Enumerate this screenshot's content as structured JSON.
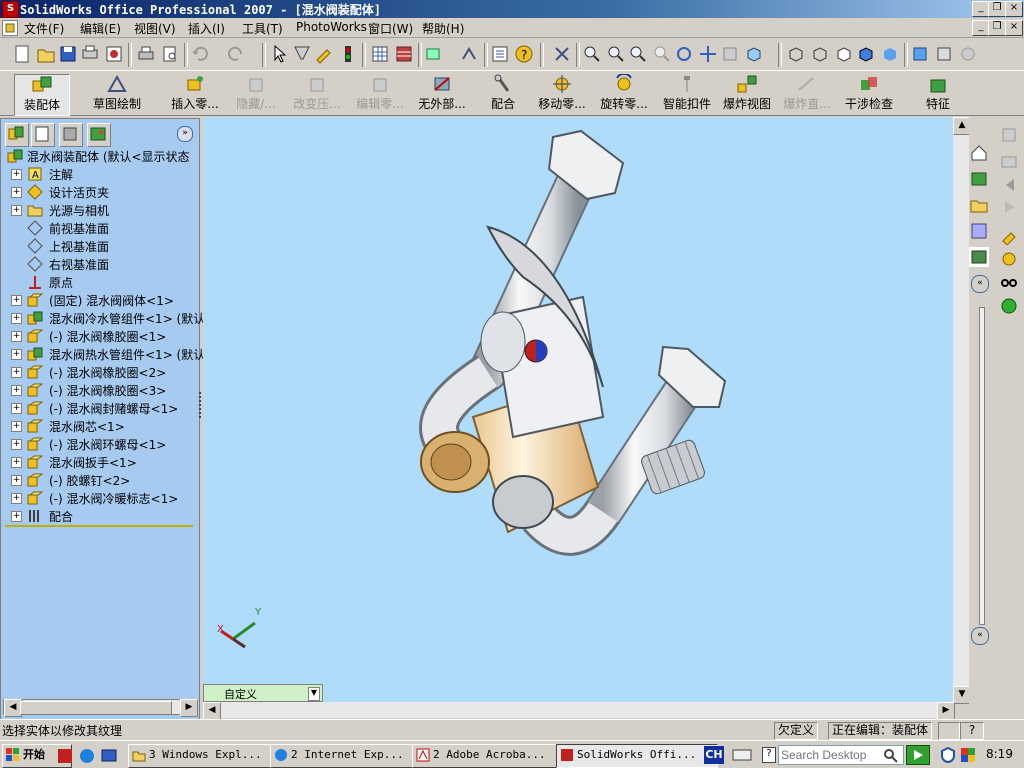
{
  "window": {
    "title": "SolidWorks Office Professional 2007 - [混水阀装配体]",
    "controls": {
      "minimize": "_",
      "restore": "❐",
      "close": "×"
    }
  },
  "menu": {
    "items": [
      "文件(F)",
      "编辑(E)",
      "视图(V)",
      "插入(I)",
      "工具(T)",
      "PhotoWorks",
      "窗口(W)",
      "帮助(H)"
    ]
  },
  "command_manager": {
    "buttons": [
      {
        "label": "装配体",
        "enabled": true
      },
      {
        "label": "草图绘制",
        "enabled": true
      },
      {
        "label": "插入零...",
        "enabled": true
      },
      {
        "label": "隐藏/...",
        "enabled": false
      },
      {
        "label": "改变压...",
        "enabled": false
      },
      {
        "label": "编辑零...",
        "enabled": false
      },
      {
        "label": "无外部...",
        "enabled": true
      },
      {
        "label": "配合",
        "enabled": true
      },
      {
        "label": "移动零...",
        "enabled": true
      },
      {
        "label": "旋转零...",
        "enabled": true
      },
      {
        "label": "智能扣件",
        "enabled": true
      },
      {
        "label": "爆炸视图",
        "enabled": true
      },
      {
        "label": "爆炸直...",
        "enabled": false
      },
      {
        "label": "干涉检查",
        "enabled": true
      },
      {
        "label": "特征",
        "enabled": true
      }
    ]
  },
  "feature_tree": {
    "root": "混水阀装配体  (默认<显示状态",
    "items": [
      {
        "label": "注解",
        "icon": "annotation-icon",
        "expander": "+"
      },
      {
        "label": "设计活页夹",
        "icon": "design-binder-icon",
        "expander": "+"
      },
      {
        "label": "光源与相机",
        "icon": "lights-camera-icon",
        "expander": "+"
      },
      {
        "label": "前视基准面",
        "icon": "plane-icon",
        "expander": ""
      },
      {
        "label": "上视基准面",
        "icon": "plane-icon",
        "expander": ""
      },
      {
        "label": "右视基准面",
        "icon": "plane-icon",
        "expander": ""
      },
      {
        "label": "原点",
        "icon": "origin-icon",
        "expander": ""
      },
      {
        "label": "(固定) 混水阀阀体<1>",
        "icon": "part-icon",
        "expander": "+"
      },
      {
        "label": "混水阀冷水管组件<1> (默认",
        "icon": "subassembly-icon",
        "expander": "+"
      },
      {
        "label": "(-) 混水阀橡胶圈<1>",
        "icon": "part-icon",
        "expander": "+"
      },
      {
        "label": "混水阀热水管组件<1> (默认",
        "icon": "subassembly-icon",
        "expander": "+"
      },
      {
        "label": "(-) 混水阀橡胶圈<2>",
        "icon": "part-icon",
        "expander": "+"
      },
      {
        "label": "(-) 混水阀橡胶圈<3>",
        "icon": "part-icon",
        "expander": "+"
      },
      {
        "label": "(-) 混水阀封赌螺母<1>",
        "icon": "part-icon",
        "expander": "+"
      },
      {
        "label": "混水阀芯<1>",
        "icon": "part-icon",
        "expander": "+"
      },
      {
        "label": "(-) 混水阀环螺母<1>",
        "icon": "part-icon",
        "expander": "+"
      },
      {
        "label": "混水阀扳手<1>",
        "icon": "part-icon",
        "expander": "+"
      },
      {
        "label": "(-) 胶螺钉<2>",
        "icon": "part-icon",
        "expander": "+"
      },
      {
        "label": "(-) 混水阀冷暖标志<1>",
        "icon": "part-icon",
        "expander": "+"
      },
      {
        "label": "配合",
        "icon": "mates-icon",
        "expander": "+"
      }
    ]
  },
  "viewport": {
    "background": "#aedcfa",
    "triad": {
      "x": "X",
      "y": "Y"
    },
    "view_config": "自定义"
  },
  "status_bar": {
    "message": "选择实体以修改其纹理",
    "units": "欠定义",
    "editing": "正在编辑：装配体",
    "help": "?"
  },
  "taskbar": {
    "start": "开始",
    "tasks": [
      {
        "label": "3 Windows Expl...",
        "icon": "folder-icon"
      },
      {
        "label": "2 Internet Exp...",
        "icon": "ie-icon"
      },
      {
        "label": "2 Adobe Acroba...",
        "icon": "acrobat-icon"
      },
      {
        "label": "SolidWorks Offi...",
        "icon": "solidworks-icon"
      }
    ],
    "lang": "CH",
    "search_placeholder": "Search Desktop",
    "clock": "8:19"
  }
}
